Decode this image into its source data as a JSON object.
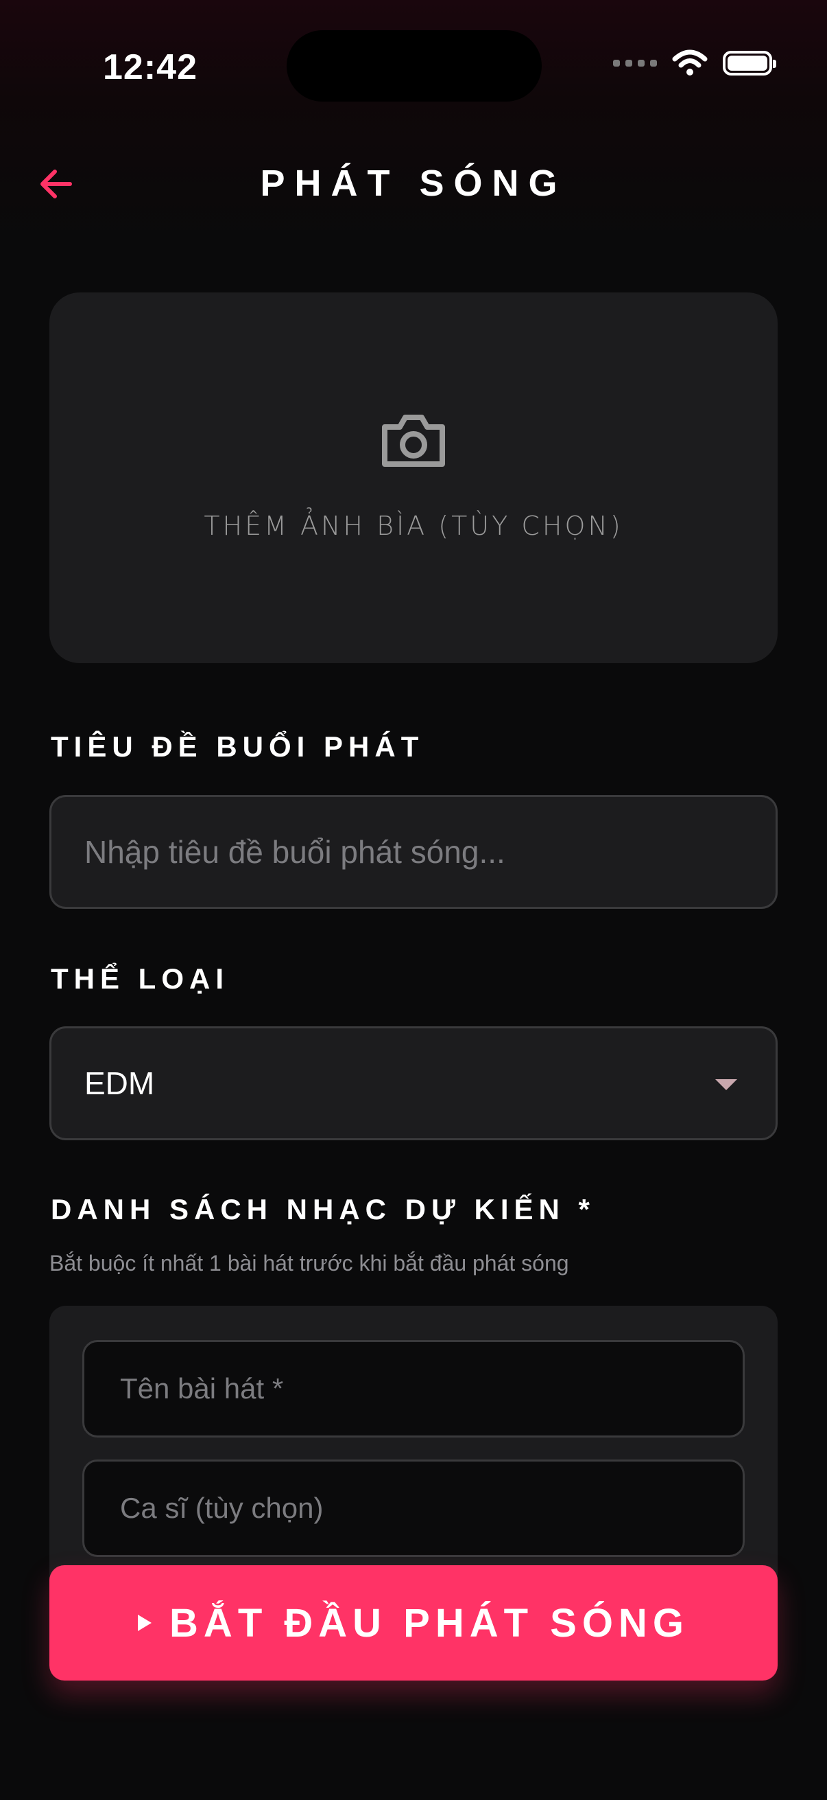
{
  "status_bar": {
    "time": "12:42"
  },
  "header": {
    "title": "PHÁT SÓNG"
  },
  "cover": {
    "label": "THÊM ẢNH BÌA (TÙY CHỌN)"
  },
  "title_section": {
    "label": "TIÊU ĐỀ BUỔI PHÁT",
    "placeholder": "Nhập tiêu đề buổi phát sóng..."
  },
  "genre_section": {
    "label": "THỂ LOẠI",
    "selected": "EDM"
  },
  "playlist_section": {
    "label": "DANH SÁCH NHẠC DỰ KIẾN *",
    "helper": "Bắt buộc ít nhất 1 bài hát trước khi bắt đầu phát sóng",
    "song_title_placeholder": "Tên bài hát *",
    "artist_placeholder": "Ca sĩ (tùy chọn)"
  },
  "cta": {
    "label": "BẮT ĐẦU PHÁT SÓNG"
  },
  "colors": {
    "accent": "#ff3366",
    "card": "#1c1c1e",
    "background": "#0a0a0b"
  }
}
